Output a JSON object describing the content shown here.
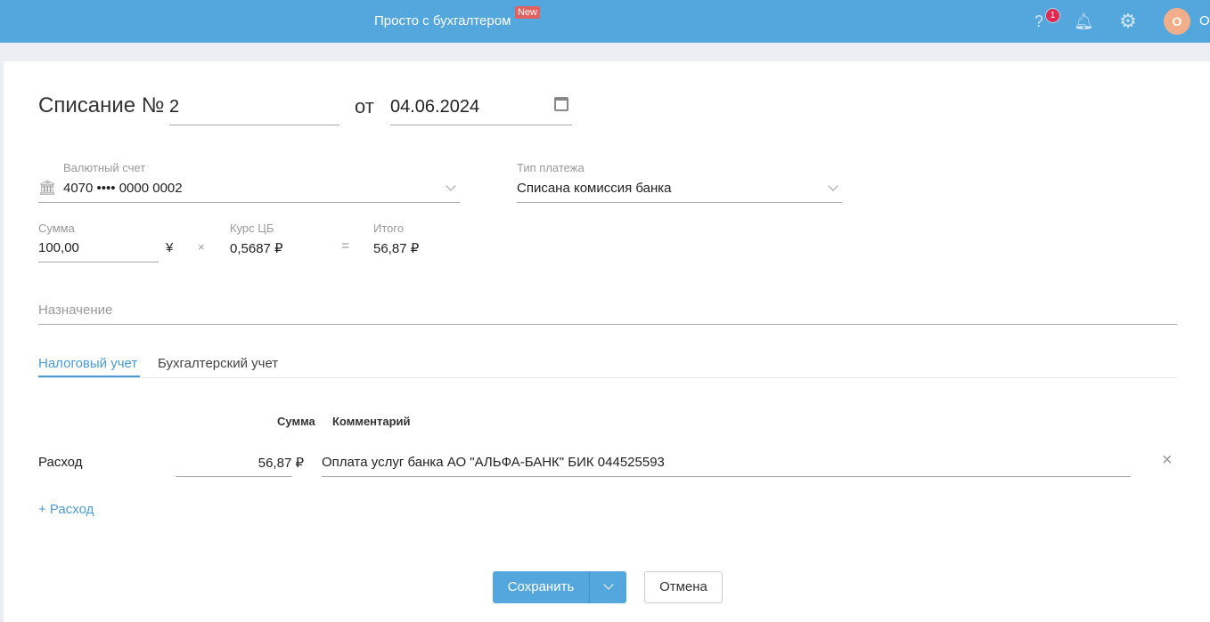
{
  "header": {
    "brand": "Просто с бухгалтером",
    "new_badge": "New",
    "help_count": "1",
    "avatar_letter": "О",
    "user_name": "О"
  },
  "doc": {
    "title": "Списание №",
    "number": "2",
    "from_label": "от",
    "date": "04.06.2024"
  },
  "account": {
    "label": "Валютный счет",
    "value": "4070 •••• 0000 0002"
  },
  "payment_type": {
    "label": "Тип платежа",
    "value": "Списана комиссия банка"
  },
  "amount": {
    "label": "Сумма",
    "value": "100,00",
    "currency": "¥",
    "times": "×",
    "rate_label": "Курс ЦБ",
    "rate": "0,5687 ₽",
    "equals": "=",
    "total_label": "Итого",
    "total": "56,87 ₽"
  },
  "purpose": {
    "placeholder": "Назначение"
  },
  "tabs": [
    {
      "label": "Налоговый учет",
      "active": true
    },
    {
      "label": "Бухгалтерский учет"
    }
  ],
  "table": {
    "headers": {
      "sum": "Сумма",
      "comment": "Комментарий"
    },
    "rows": [
      {
        "type": "Расход",
        "sum": "56,87 ₽",
        "comment": "Оплата услуг банка АО \"АЛЬФА-БАНК\" БИК 044525593"
      }
    ]
  },
  "add_expense": "+ Расход",
  "buttons": {
    "save": "Сохранить",
    "cancel": "Отмена"
  },
  "colors": {
    "primary": "#53a7dc",
    "badge": "#e02850"
  }
}
